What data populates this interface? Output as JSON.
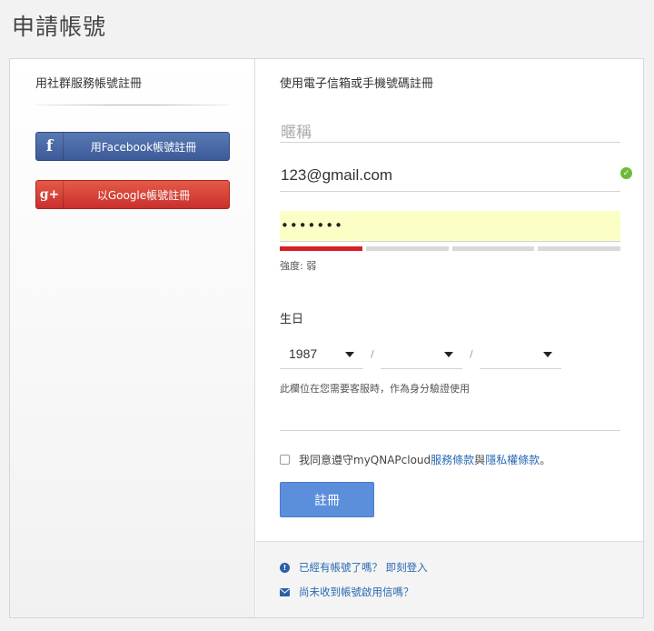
{
  "page": {
    "title": "申請帳號"
  },
  "social": {
    "heading": "用社群服務帳號註冊",
    "facebook": {
      "icon": "f",
      "label": "用Facebook帳號註冊"
    },
    "google": {
      "icon": "g+",
      "label": "以Google帳號註冊"
    }
  },
  "form": {
    "heading": "使用電子信箱或手機號碼註冊",
    "nickname": {
      "placeholder": "暱稱",
      "value": ""
    },
    "email": {
      "value": "123@gmail.com",
      "valid": true
    },
    "password": {
      "masked": "•••••••"
    },
    "strength": {
      "label": "強度: 弱",
      "level": 1,
      "max": 4
    },
    "birthday": {
      "label": "生日",
      "year": "1987",
      "month": "",
      "day": "",
      "separator": "/",
      "note": "此欄位在您需要客服時，作為身分驗證使用"
    },
    "agree": {
      "prefix": "我同意遵守myQNAPcloud",
      "terms_link": "服務條款",
      "and": "與",
      "privacy_link": "隱私權條款",
      "suffix": "。",
      "checked": false
    },
    "submit_label": "註冊"
  },
  "footer_links": {
    "login": "已經有帳號了嗎？ 即刻登入",
    "resend": "尚未收到帳號啟用信嗎？"
  },
  "colors": {
    "facebook": "#3c5a98",
    "google": "#c9302c",
    "accent": "#5b8fdb",
    "link": "#2a6ab3",
    "strength_weak": "#d62028",
    "valid": "#6dbb3a",
    "password_bg": "#fbffc6"
  }
}
